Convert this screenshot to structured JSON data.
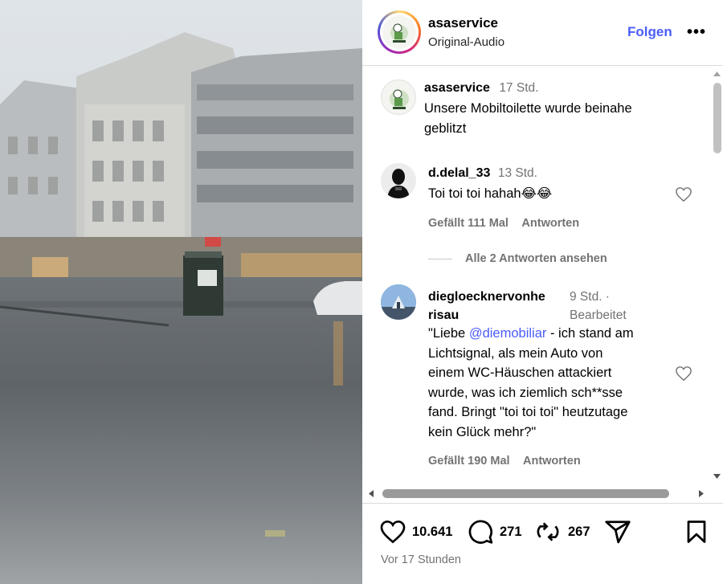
{
  "post": {
    "username": "asaservice",
    "audio": "Original-Audio",
    "follow_label": "Folgen",
    "more_label": "•••",
    "avatar_icon": "asaservice-logo-icon"
  },
  "caption": {
    "username": "asaservice",
    "time": "17 Std.",
    "text_line1": "Unsere Mobiltoilette wurde beinahe",
    "text_line2": "geblitzt"
  },
  "comments": [
    {
      "username": "d.delal_33",
      "time": "13 Std.",
      "text": "Toi toi toi hahah😂😂",
      "likes": "Gefällt 111 Mal",
      "reply_label": "Antworten",
      "view_replies": "Alle 2 Antworten ansehen"
    },
    {
      "username_line1": "diegloecknervonhe",
      "username_line2": "risau",
      "time_line1": "9 Std. ·",
      "time_line2": "Bearbeitet",
      "text_line1_pre": "\"Liebe ",
      "mention": "@diemobiliar",
      "text_line1_post": " - ich stand am",
      "text_line2": "Lichtsignal, als mein Auto von",
      "text_line3": "einem WC-Häuschen attackiert",
      "text_line4": "wurde, was ich ziemlich sch**sse",
      "text_line5": "fand. Bringt \"toi toi toi\" heutzutage",
      "text_line6": "kein Glück mehr?\"",
      "likes": "Gefällt 190 Mal",
      "reply_label": "Antworten"
    }
  ],
  "actions": {
    "likes": "10.641",
    "comments": "271",
    "reposts": "267",
    "posted_ago": "Vor 17 Stunden"
  },
  "colors": {
    "accent": "#4a5df9",
    "muted": "#737373"
  }
}
